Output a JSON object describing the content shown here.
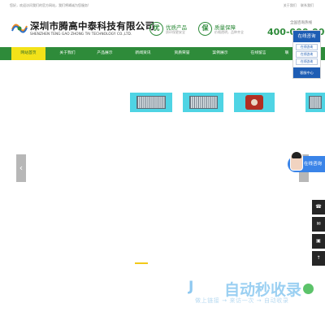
{
  "topbar": {
    "welcome": "您好，欢迎访问我们的官方网站，我们将竭诚为您服务!",
    "links": [
      "关于我们",
      "联系我们"
    ]
  },
  "header": {
    "brand_cn": "深圳市腾高中泰科技有限公司",
    "brand_en": "SHENZHEN TENG GAO ZHONG TAI TECHNOLOGY CO.,LTD.",
    "features": [
      {
        "icon": "优",
        "title": "优质产品",
        "desc": "质环保更安全"
      },
      {
        "icon": "保",
        "title": "质量保障",
        "desc": "价格透明，品种齐全"
      }
    ],
    "hotline_label": "全国咨询热线",
    "hotline": "400-000-0000"
  },
  "nav": {
    "items": [
      "网站首页",
      "关于我们",
      "产品展示",
      "新闻资讯",
      "资质荣誉",
      "案例展示",
      "在线留言",
      "联"
    ]
  },
  "float_panel": {
    "title": "在线咨询",
    "qq": [
      "在线咨询",
      "在线咨询",
      "在线咨询"
    ],
    "footer": "客服中心"
  },
  "chat": {
    "label": "在线咨询"
  },
  "tools": {
    "icons": [
      "phone-icon",
      "chat-icon",
      "qrcode-icon",
      "top-icon"
    ]
  },
  "watermark": {
    "title": "自动秒收录",
    "subtitle": "做上链接 → 来访一次 → 自动收录"
  },
  "colors": {
    "brand_green": "#2e8b3a",
    "nav_active": "#f3e219",
    "accent_blue": "#1e5db4",
    "product_bg": "#4fd4e4"
  },
  "products": [
    {
      "type": "grille",
      "icon": "fan-grille-icon"
    },
    {
      "type": "grille",
      "icon": "fan-grille-icon"
    },
    {
      "type": "grille",
      "icon": "fan-grille-icon"
    },
    {
      "type": "device",
      "icon": "detector-device-icon"
    },
    {
      "type": "partial",
      "icon": "product-edge-icon"
    }
  ]
}
